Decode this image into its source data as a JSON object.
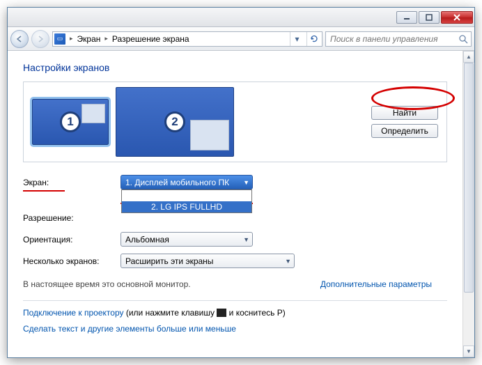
{
  "breadcrumb": {
    "item1": "Экран",
    "item2": "Разрешение экрана"
  },
  "search": {
    "placeholder": "Поиск в панели управления"
  },
  "title": "Настройки экранов",
  "buttons": {
    "find": "Найти",
    "identify": "Определить"
  },
  "monitors": {
    "num1": "1",
    "num2": "2"
  },
  "labels": {
    "screen": "Экран:",
    "resolution": "Разрешение:",
    "orientation": "Ориентация:",
    "multiple": "Несколько экранов:"
  },
  "dropdowns": {
    "screen_value": "1. Дисплей мобильного ПК",
    "screen_opt1": "1. Дисплей мобильного ПК",
    "screen_opt2": "2. LG IPS FULLHD",
    "orientation_value": "Альбомная",
    "multiple_value": "Расширить эти экраны"
  },
  "note": "В настоящее время это основной монитор.",
  "advanced": "Дополнительные параметры",
  "projector_link": "Подключение к проектору",
  "projector_rest1": " (или нажмите клавишу ",
  "projector_rest2": " и коснитесь P)",
  "textsize_link": "Сделать текст и другие элементы больше или меньше"
}
